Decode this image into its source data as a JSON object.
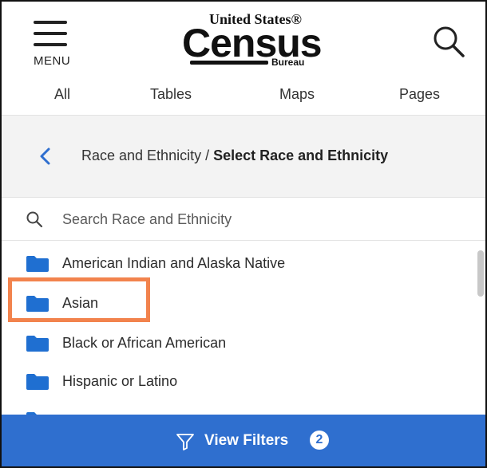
{
  "header": {
    "menu_label": "MENU",
    "logo": {
      "top_line": "United States®",
      "main": "Census",
      "bottom_line": "Bureau"
    },
    "tabs": [
      {
        "label": "All"
      },
      {
        "label": "Tables"
      },
      {
        "label": "Maps"
      },
      {
        "label": "Pages"
      }
    ]
  },
  "breadcrumb": {
    "parent": "Race and Ethnicity",
    "separator": " / ",
    "current": "Select Race and Ethnicity"
  },
  "search": {
    "placeholder": "Search Race and Ethnicity",
    "value": ""
  },
  "list": {
    "items": [
      {
        "label": "American Indian and Alaska Native",
        "icon": "folder-icon"
      },
      {
        "label": "Asian",
        "icon": "folder-icon",
        "highlighted": true
      },
      {
        "label": "Black or African American",
        "icon": "folder-icon"
      },
      {
        "label": "Hispanic or Latino",
        "icon": "folder-icon"
      }
    ]
  },
  "footer": {
    "filter_label": "View Filters",
    "filter_count": "2"
  },
  "colors": {
    "accent": "#2f6fcf",
    "folder": "#1f6fd1",
    "highlight": "#f2834d",
    "panel": "#f3f3f3"
  }
}
